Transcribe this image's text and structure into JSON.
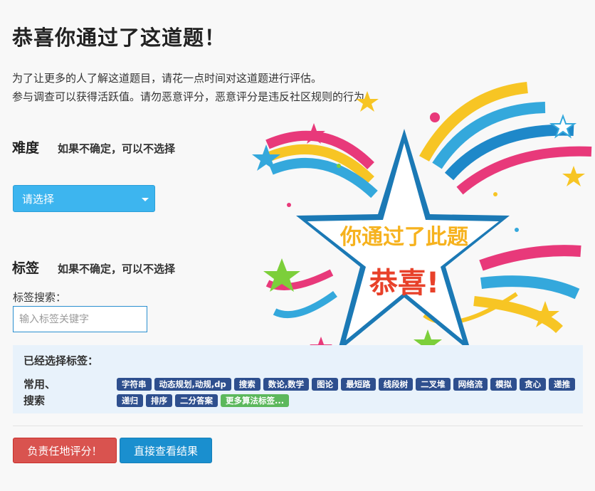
{
  "title": "恭喜你通过了这道题！",
  "intro": {
    "line1": "为了让更多的人了解这道题目，请花一点时间对这道题进行评估。",
    "line2": "参与调查可以获得活跃值。请勿恶意评分，恶意评分是违反社区规则的行为。"
  },
  "difficulty": {
    "heading": "难度",
    "hint": "如果不确定，可以不选择",
    "select_value": "请选择"
  },
  "tags": {
    "heading": "标签",
    "hint": "如果不确定，可以不选择",
    "search_label": "标签搜索：",
    "search_placeholder": "输入标签关键字"
  },
  "selected": {
    "heading": "已经选择标签：",
    "group_line1": "常用、",
    "group_line2": "搜索",
    "items": [
      "字符串",
      "动态规划,动规,dp",
      "搜索",
      "数论,数学",
      "图论",
      "最短路",
      "线段树",
      "二叉堆",
      "网络流",
      "模拟",
      "贪心",
      "递推",
      "递归",
      "排序",
      "二分答案"
    ],
    "more_label": "更多算法标签..."
  },
  "buttons": {
    "rate": "负责任地评分！",
    "skip": "直接查看结果"
  },
  "art": {
    "line1": "你通过了此题",
    "line2": "恭喜!"
  },
  "colors": {
    "select": "#3db5ef",
    "tag": "#2e4f8e",
    "tag_more": "#5cb85c",
    "rate_button": "#d9534f",
    "skip_button": "#1a8fcf",
    "panel": "#e8f2fb"
  }
}
